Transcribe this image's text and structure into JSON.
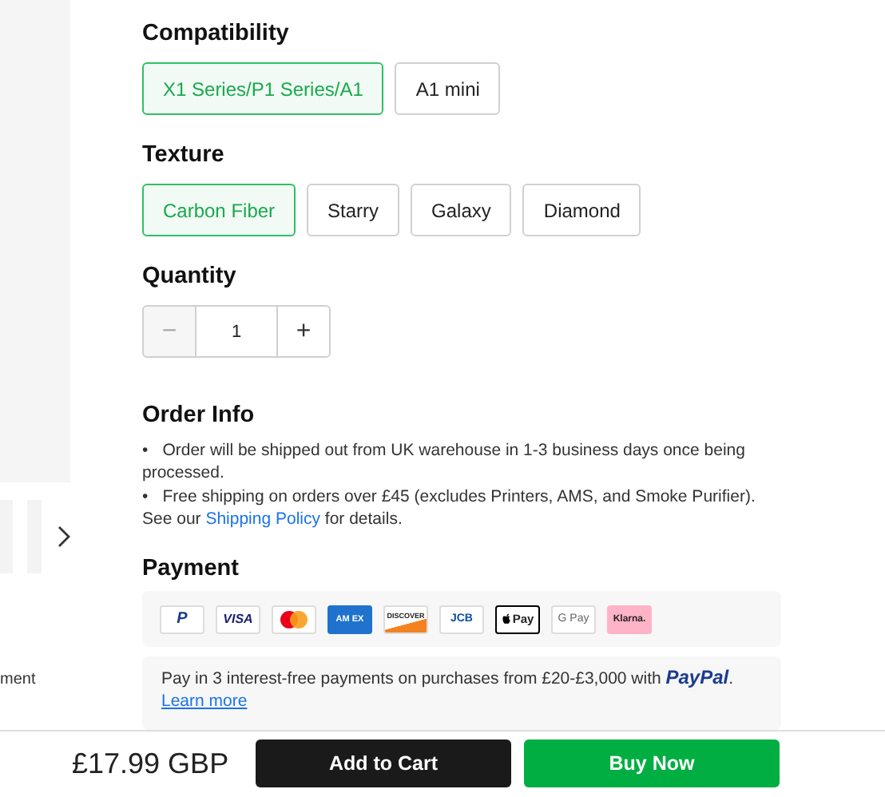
{
  "option_groups": [
    {
      "title": "Compatibility",
      "options": [
        {
          "label": "X1 Series/P1 Series/A1",
          "selected": true
        },
        {
          "label": "A1 mini",
          "selected": false
        }
      ]
    },
    {
      "title": "Texture",
      "options": [
        {
          "label": "Carbon Fiber",
          "selected": true
        },
        {
          "label": "Starry",
          "selected": false
        },
        {
          "label": "Galaxy",
          "selected": false
        },
        {
          "label": "Diamond",
          "selected": false
        }
      ]
    }
  ],
  "quantity": {
    "title": "Quantity",
    "minus": "−",
    "value": "1",
    "plus": "+",
    "minus_disabled": true
  },
  "order_info": {
    "title": "Order Info",
    "bullet": "•",
    "items": [
      "Order will be shipped out from UK warehouse in 1-3 business days once being processed.",
      "Free shipping on orders over £45 (excludes Printers, AMS, and Smoke Purifier)."
    ],
    "note": {
      "before": "See our",
      "link": "Shipping Policy",
      "after": "for details."
    }
  },
  "payment": {
    "title": "Payment",
    "methods": [
      {
        "kind": "paypal",
        "label": "P"
      },
      {
        "kind": "visa",
        "label": "VISA"
      },
      {
        "kind": "mastercard"
      },
      {
        "kind": "amex",
        "label": "AM EX"
      },
      {
        "kind": "discover",
        "label": "DISCOVER"
      },
      {
        "kind": "jcb",
        "label": "JCB"
      },
      {
        "kind": "applepay",
        "label": "Pay"
      },
      {
        "kind": "googlepay",
        "label": "G Pay"
      },
      {
        "kind": "klarna",
        "label": "Klarna."
      }
    ],
    "paylater": {
      "text": "Pay in 3 interest-free payments on purchases from £20-£3,000 with",
      "brand": "PayPal",
      "end": ".",
      "link": "Learn more"
    }
  },
  "side": {
    "text": "ment"
  },
  "buy_bar": {
    "price": "£17.99 GBP",
    "add_to_cart": "Add to Cart",
    "buy_now": "Buy Now"
  }
}
